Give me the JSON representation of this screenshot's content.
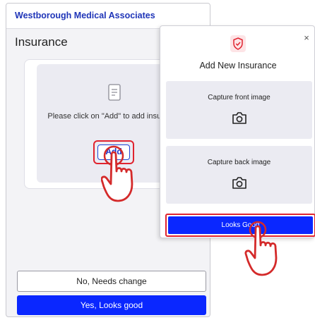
{
  "app": {
    "title": "Westborough Medical Associates"
  },
  "page": {
    "title": "Insurance"
  },
  "card": {
    "message": "Please click on \"Add\" to add insurance",
    "add_label": "Add"
  },
  "footer": {
    "needs_change_label": "No, Needs change",
    "looks_good_label": "Yes, Looks good"
  },
  "modal": {
    "title": "Add New Insurance",
    "close_label": "×",
    "front_label": "Capture front image",
    "back_label": "Capture back image",
    "looks_good_label": "Looks Good"
  },
  "colors": {
    "brand_blue": "#1f35b8",
    "primary_button": "#0a27ff",
    "highlight_red": "#e0232f",
    "hand_red": "#d42a2a"
  },
  "icons": {
    "document": "document-icon",
    "shield": "shield-icon",
    "camera": "camera-icon",
    "pointer": "pointing-hand-icon",
    "close": "close-icon"
  }
}
